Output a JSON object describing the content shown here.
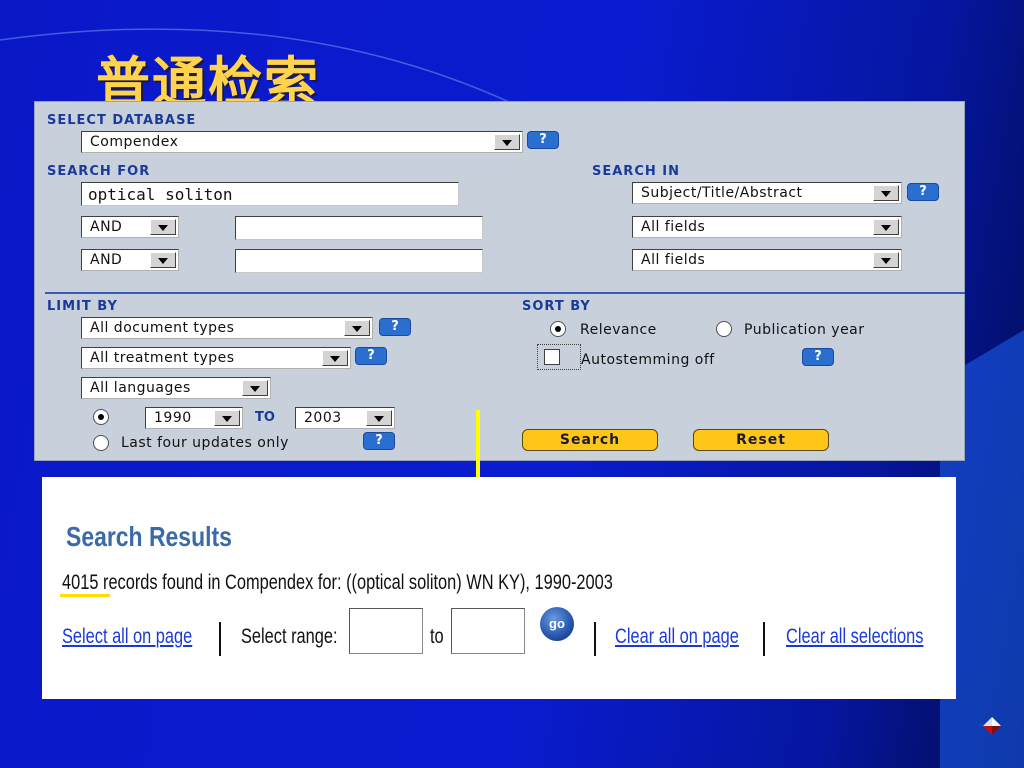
{
  "slide": {
    "title": "普通检索"
  },
  "search_panel": {
    "select_database": {
      "label": "SELECT DATABASE",
      "value": "Compendex"
    },
    "search_for": {
      "label": "SEARCH FOR",
      "term1": "optical soliton",
      "connector1": "AND",
      "term2": "",
      "connector2": "AND",
      "term3": ""
    },
    "search_in": {
      "label": "SEARCH IN",
      "field1": "Subject/Title/Abstract",
      "field2": "All fields",
      "field3": "All fields"
    },
    "limit_by": {
      "label": "LIMIT BY",
      "doc_types": "All document types",
      "treatment_types": "All treatment types",
      "languages": "All languages",
      "year_from": "1990",
      "to_label": "TO",
      "year_to": "2003",
      "last_updates_label": "Last four updates only"
    },
    "sort_by": {
      "label": "SORT BY",
      "relevance": "Relevance",
      "publication_year": "Publication year",
      "autostemming": "Autostemming off"
    },
    "help_glyph": "?",
    "buttons": {
      "search": "Search",
      "reset": "Reset"
    }
  },
  "results_panel": {
    "title": "Search Results",
    "count": "4015",
    "summary_rest": " records found in Compendex for: ((optical soliton) WN KY), 1990-2003",
    "select_all": "Select all on page",
    "select_range": "Select range:",
    "to": "to",
    "go": "go",
    "clear_page": "Clear all on page",
    "clear_all": "Clear all selections"
  },
  "colors": {
    "background": "#0a18c8",
    "title": "#ffd34d",
    "panel": "#c8d0dc",
    "section_label": "#1a3a9a",
    "help_button": "#2a6fd0",
    "action_button": "#ffc61a",
    "arrow": "#ffff00",
    "link": "#1a3ad8"
  },
  "icons": {
    "help": "question-icon",
    "dropdown": "chevron-down-icon",
    "go": "go-button-icon",
    "nav": "diamond-nav-icon"
  }
}
